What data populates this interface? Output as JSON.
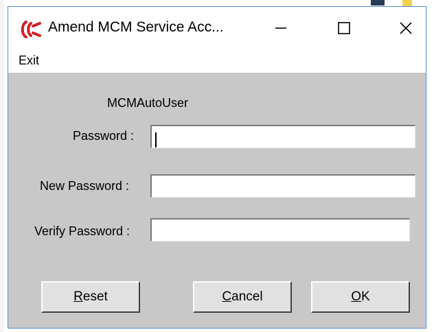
{
  "window": {
    "title": "Amend MCM Service Acc...",
    "controls": {
      "minimize": "—",
      "maximize": "☐",
      "close": "✕"
    },
    "accent_color": "#4d8fd6",
    "logo_color": "#d21f26"
  },
  "menu": {
    "exit_label": "Exit"
  },
  "form": {
    "username": "MCMAutoUser",
    "password_label": "Password :",
    "new_password_label": "New Password :",
    "verify_password_label": "Verify Password :",
    "password_value": "",
    "new_password_value": "",
    "verify_password_value": ""
  },
  "buttons": {
    "reset": {
      "accel": "R",
      "rest": "eset"
    },
    "cancel": {
      "accel": "C",
      "rest": "ancel"
    },
    "ok": {
      "accel": "O",
      "rest": "K"
    }
  }
}
